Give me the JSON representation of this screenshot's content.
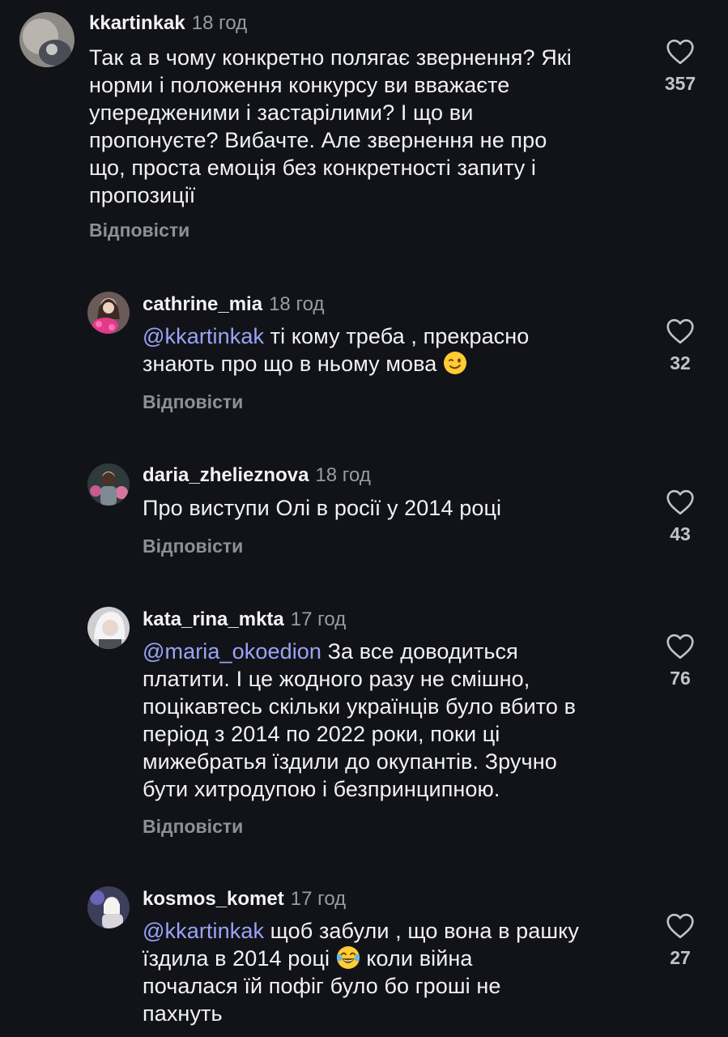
{
  "reply_label": "Відповісти",
  "colors": {
    "background": "#121318",
    "text": "#f2f2f4",
    "muted": "#8e8f97",
    "mention": "#9aa4f7"
  },
  "comments": [
    {
      "username": "kkartinkak",
      "time": "18 год",
      "lines": [
        "Так а в чому конкретно полягає звернення? Які",
        "норми і положення конкурсу ви вважаєте",
        "упередженими і застарілими? І що ви",
        "пропонуєте? Вибачте. Але звернення не про",
        "що, проста емоція без конкретності запиту і",
        "пропозиції"
      ],
      "likes": "357"
    },
    {
      "username": "cathrine_mia",
      "time": "18 год",
      "mention": "@kkartinkak",
      "line1_rest": " ті кому треба , прекрасно",
      "line2": "знають про що в ньому мова",
      "emoji": "winking-face",
      "likes": "32"
    },
    {
      "username": "daria_zhelieznova",
      "time": "18 год",
      "text": "Про виступи Олі в росії у 2014 році",
      "likes": "43"
    },
    {
      "username": "kata_rina_mkta",
      "time": "17 год",
      "mention": "@maria_okoedion",
      "line1_rest": " За все доводиться",
      "lines": [
        "платити. І це жодного разу не смішно,",
        "поцікавтесь скільки українців було вбито в",
        "період з 2014 по 2022 роки, поки ці",
        "мижебратья їздили до окупантів. Зручно",
        "бути хитродупою і безпринципною."
      ],
      "likes": "76"
    },
    {
      "username": "kosmos_komet",
      "time": "17 год",
      "mention": "@kkartinkak",
      "line1_rest": " щоб забули , що вона в рашку",
      "line2_before": "їздила в 2014 році ",
      "emoji": "face-with-tears-of-joy",
      "line2_after": " коли війна",
      "lines": [
        "почалася їй пофіг було бо гроші не",
        "пахнуть"
      ],
      "likes": "27"
    }
  ]
}
